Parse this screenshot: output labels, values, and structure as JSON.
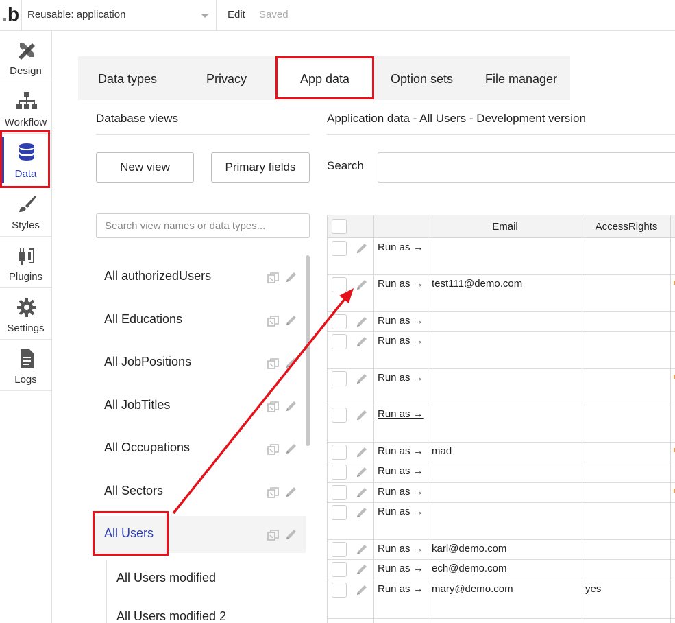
{
  "topbar": {
    "logo": "b",
    "app_name": "Reusable: application",
    "edit": "Edit",
    "status": "Saved"
  },
  "nav": {
    "items": [
      {
        "label": "Design",
        "icon": "design-icon"
      },
      {
        "label": "Workflow",
        "icon": "workflow-icon"
      },
      {
        "label": "Data",
        "icon": "database-icon"
      },
      {
        "label": "Styles",
        "icon": "brush-icon"
      },
      {
        "label": "Plugins",
        "icon": "plug-icon"
      },
      {
        "label": "Settings",
        "icon": "gear-icon"
      },
      {
        "label": "Logs",
        "icon": "document-icon"
      }
    ],
    "active": "Data"
  },
  "tabs": [
    {
      "label": "Data types"
    },
    {
      "label": "Privacy"
    },
    {
      "label": "App data"
    },
    {
      "label": "Option sets"
    },
    {
      "label": "File manager"
    }
  ],
  "views_panel": {
    "title": "Database views",
    "new_view": "New view",
    "primary_fields": "Primary fields",
    "search_placeholder": "Search view names or data types...",
    "views": [
      {
        "label": "All authorizedUsers"
      },
      {
        "label": "All Educations"
      },
      {
        "label": "All JobPositions"
      },
      {
        "label": "All JobTitles"
      },
      {
        "label": "All Occupations"
      },
      {
        "label": "All Sectors"
      },
      {
        "label": "All Users"
      }
    ],
    "selected": "All Users",
    "sub_views": [
      {
        "label": "All Users modified"
      },
      {
        "label": "All Users modified 2"
      }
    ]
  },
  "data_panel": {
    "title": "Application data - All Users - Development version",
    "search_label": "Search",
    "columns": [
      "",
      "",
      "Email",
      "AccessRights"
    ],
    "rows": [
      {
        "run_as": "Run as →",
        "email": "",
        "access": ""
      },
      {
        "run_as": "Run as →",
        "email": "test111@demo.com",
        "access": ""
      },
      {
        "run_as": "Run as →",
        "email": "",
        "access": ""
      },
      {
        "run_as": "Run as →",
        "email": "",
        "access": ""
      },
      {
        "run_as": "Run as →",
        "email": "",
        "access": ""
      },
      {
        "run_as": "Run as →",
        "email": "",
        "access": ""
      },
      {
        "run_as": "Run as →",
        "email": "mad",
        "access": ""
      },
      {
        "run_as": "Run as →",
        "email": "",
        "access": ""
      },
      {
        "run_as": "Run as →",
        "email": "",
        "access": ""
      },
      {
        "run_as": "Run as →",
        "email": "",
        "access": ""
      },
      {
        "run_as": "Run as →",
        "email": "karl@demo.com",
        "access": ""
      },
      {
        "run_as": "Run as →",
        "email": "ech@demo.com",
        "access": ""
      },
      {
        "run_as": "Run as →",
        "email": "mary@demo.com",
        "access": "yes"
      }
    ]
  },
  "colors": {
    "accent": "#2f3fb0",
    "highlight": "#e4131b",
    "tab_bg": "#f3f3f3"
  }
}
